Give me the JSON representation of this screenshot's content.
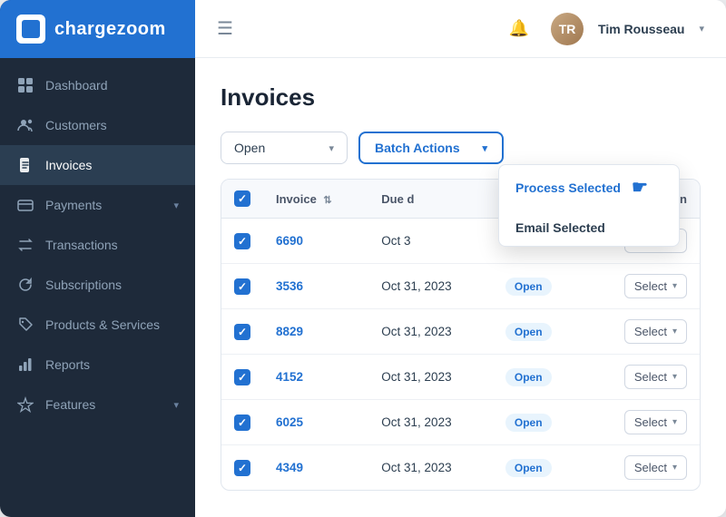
{
  "app": {
    "name": "chargezoom"
  },
  "topbar": {
    "user_name": "Tim Rousseau",
    "user_initials": "TR"
  },
  "sidebar": {
    "items": [
      {
        "id": "dashboard",
        "label": "Dashboard",
        "icon": "grid",
        "active": false,
        "has_chevron": false
      },
      {
        "id": "customers",
        "label": "Customers",
        "icon": "users",
        "active": false,
        "has_chevron": false
      },
      {
        "id": "invoices",
        "label": "Invoices",
        "icon": "file",
        "active": true,
        "has_chevron": false
      },
      {
        "id": "payments",
        "label": "Payments",
        "icon": "credit-card",
        "active": false,
        "has_chevron": true
      },
      {
        "id": "transactions",
        "label": "Transactions",
        "icon": "repeat",
        "active": false,
        "has_chevron": false
      },
      {
        "id": "subscriptions",
        "label": "Subscriptions",
        "icon": "refresh",
        "active": false,
        "has_chevron": false
      },
      {
        "id": "products",
        "label": "Products & Services",
        "icon": "tag",
        "active": false,
        "has_chevron": false
      },
      {
        "id": "reports",
        "label": "Reports",
        "icon": "bar-chart",
        "active": false,
        "has_chevron": false
      },
      {
        "id": "features",
        "label": "Features",
        "icon": "star",
        "active": false,
        "has_chevron": true
      }
    ]
  },
  "page": {
    "title": "Invoices"
  },
  "toolbar": {
    "filter_label": "Open",
    "batch_label": "Batch Actions",
    "filter_placeholder": "Open"
  },
  "dropdown": {
    "items": [
      {
        "id": "process",
        "label": "Process Selected",
        "highlight": true
      },
      {
        "id": "email",
        "label": "Email Selected",
        "highlight": false
      }
    ]
  },
  "table": {
    "columns": [
      {
        "id": "check",
        "label": ""
      },
      {
        "id": "invoice",
        "label": "Invoice"
      },
      {
        "id": "due_date",
        "label": "Due d"
      },
      {
        "id": "status",
        "label": ""
      },
      {
        "id": "action",
        "label": "Action"
      }
    ],
    "rows": [
      {
        "id": "row1",
        "invoice": "6690",
        "due_date": "Oct 3",
        "status": "",
        "partial": true
      },
      {
        "id": "row2",
        "invoice": "3536",
        "due_date": "Oct 31, 2023",
        "status": "Open",
        "partial": false
      },
      {
        "id": "row3",
        "invoice": "8829",
        "due_date": "Oct 31, 2023",
        "status": "Open",
        "partial": false
      },
      {
        "id": "row4",
        "invoice": "4152",
        "due_date": "Oct 31, 2023",
        "status": "Open",
        "partial": false
      },
      {
        "id": "row5",
        "invoice": "6025",
        "due_date": "Oct 31, 2023",
        "status": "Open",
        "partial": false
      },
      {
        "id": "row6",
        "invoice": "4349",
        "due_date": "Oct 31, 2023",
        "status": "Open",
        "partial": false
      }
    ],
    "action_label": "Select"
  },
  "colors": {
    "sidebar_bg": "#1e2a3a",
    "sidebar_active": "#2b3e52",
    "accent": "#2271d1",
    "logo_bg": "#2271d1"
  }
}
